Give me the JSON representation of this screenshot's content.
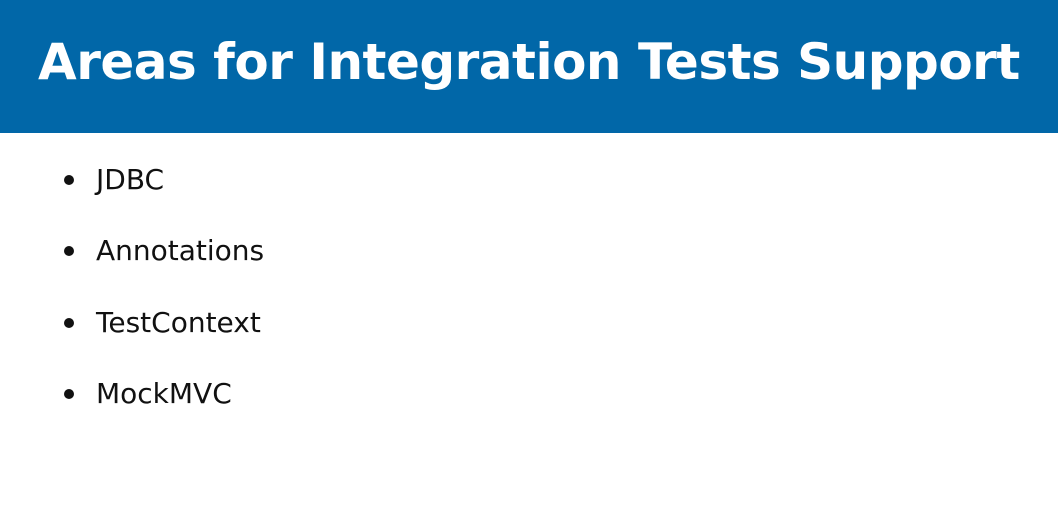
{
  "slide": {
    "title": "Areas for Integration Tests Support",
    "colors": {
      "header_background": "#0167a8",
      "title_text": "#ffffff",
      "body_text": "#111111",
      "background": "#ffffff"
    },
    "bullets": [
      {
        "label": "JDBC"
      },
      {
        "label": "Annotations"
      },
      {
        "label": "TestContext"
      },
      {
        "label": "MockMVC"
      }
    ]
  }
}
